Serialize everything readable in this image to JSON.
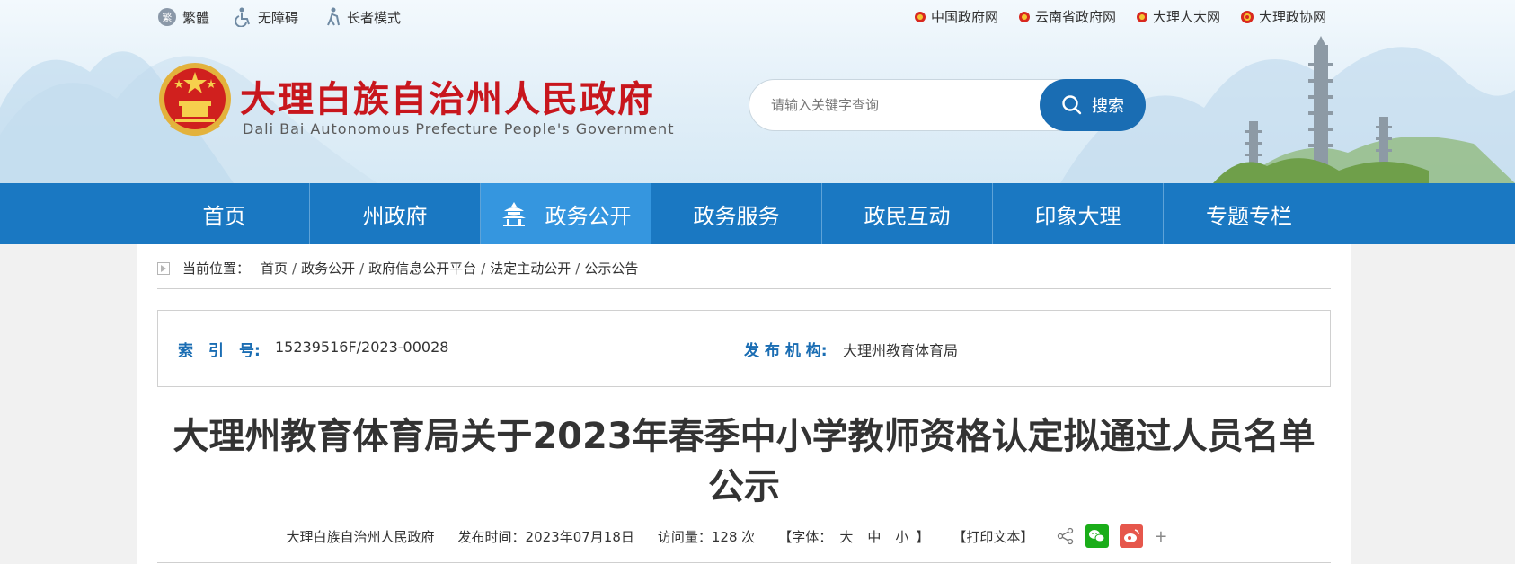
{
  "header": {
    "top_left": {
      "traditional": "繁體",
      "accessibility": "无障碍",
      "elderly_mode": "长者模式"
    },
    "top_right": {
      "links": [
        "中国政府网",
        "云南省政府网",
        "大理人大网",
        "大理政协网"
      ]
    },
    "site_title_cn": "大理白族自治州人民政府",
    "site_title_en": "Dali Bai Autonomous Prefecture People's Government",
    "search": {
      "placeholder": "请输入关键字查询",
      "button_label": "搜索"
    }
  },
  "nav": {
    "items": [
      "首页",
      "州政府",
      "政务公开",
      "政务服务",
      "政民互动",
      "印象大理",
      "专题专栏"
    ],
    "active_index": 2
  },
  "breadcrumb": {
    "prefix": "当前位置：",
    "items": [
      "首页",
      "政务公开",
      "政府信息公开平台",
      "法定主动公开",
      "公示公告"
    ],
    "separator": "/"
  },
  "meta": {
    "index_label": "索　引　号:",
    "index_value": "15239516F/2023-00028",
    "publisher_label": "发 布 机 构:",
    "publisher_value": "大理州教育体育局"
  },
  "article": {
    "title_line1": "大理州教育体育局关于2023年春季中小学教师资格认定拟通过人员名单",
    "title_line2": "公示",
    "source": "大理白族自治州人民政府",
    "publish_time": "发布时间：2023年07月18日",
    "visits": "访问量：128 次",
    "font_prefix": "【字体：",
    "font_large": "大",
    "font_medium": "中",
    "font_small": "小",
    "font_suffix": "】",
    "print_label": "【打印文本】",
    "more": "+"
  },
  "colors": {
    "nav_bg": "#1a78c2",
    "nav_active": "#3596df",
    "title_red": "#c8161d",
    "accent_blue": "#1a6db3",
    "wechat_green": "#1aad19",
    "weibo_red": "#e6574c"
  }
}
